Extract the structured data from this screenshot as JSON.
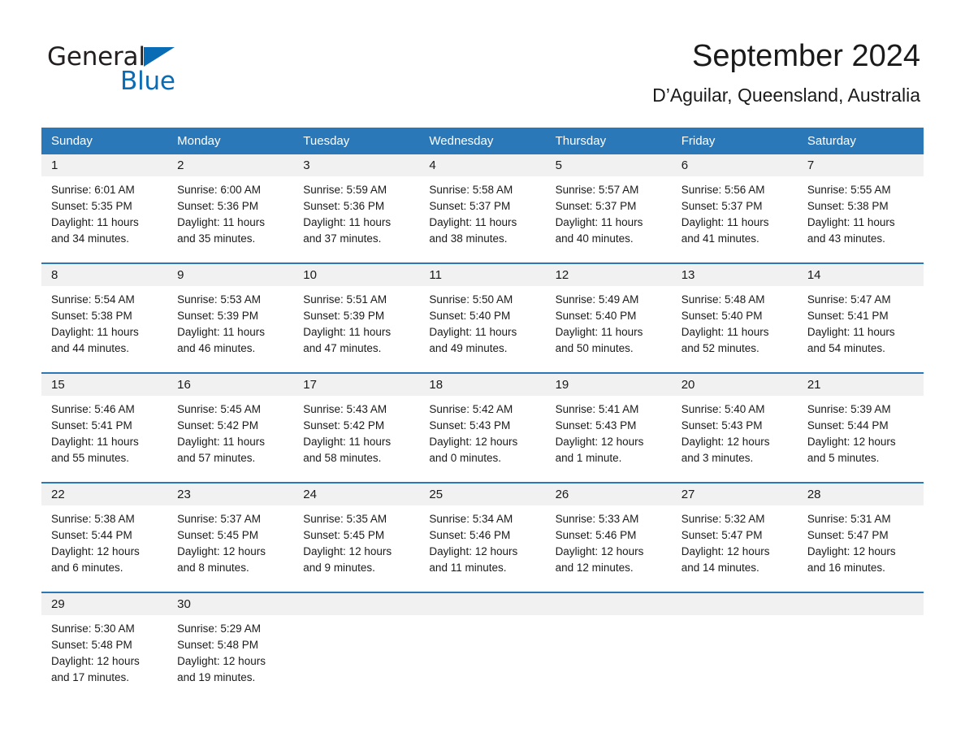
{
  "brand": {
    "word1": "General",
    "word2": "Blue",
    "triangle_color": "#0a6cb4"
  },
  "header": {
    "title": "September 2024",
    "location": "D’Aguilar, Queensland, Australia"
  },
  "theme": {
    "header_blue": "#2b78b9",
    "daynum_band": "#f1f1f1",
    "text": "#1a1a1a"
  },
  "weekdays": [
    "Sunday",
    "Monday",
    "Tuesday",
    "Wednesday",
    "Thursday",
    "Friday",
    "Saturday"
  ],
  "weeks": [
    [
      {
        "day": "1",
        "sunrise": "Sunrise: 6:01 AM",
        "sunset": "Sunset: 5:35 PM",
        "daylight": "Daylight: 11 hours and 34 minutes."
      },
      {
        "day": "2",
        "sunrise": "Sunrise: 6:00 AM",
        "sunset": "Sunset: 5:36 PM",
        "daylight": "Daylight: 11 hours and 35 minutes."
      },
      {
        "day": "3",
        "sunrise": "Sunrise: 5:59 AM",
        "sunset": "Sunset: 5:36 PM",
        "daylight": "Daylight: 11 hours and 37 minutes."
      },
      {
        "day": "4",
        "sunrise": "Sunrise: 5:58 AM",
        "sunset": "Sunset: 5:37 PM",
        "daylight": "Daylight: 11 hours and 38 minutes."
      },
      {
        "day": "5",
        "sunrise": "Sunrise: 5:57 AM",
        "sunset": "Sunset: 5:37 PM",
        "daylight": "Daylight: 11 hours and 40 minutes."
      },
      {
        "day": "6",
        "sunrise": "Sunrise: 5:56 AM",
        "sunset": "Sunset: 5:37 PM",
        "daylight": "Daylight: 11 hours and 41 minutes."
      },
      {
        "day": "7",
        "sunrise": "Sunrise: 5:55 AM",
        "sunset": "Sunset: 5:38 PM",
        "daylight": "Daylight: 11 hours and 43 minutes."
      }
    ],
    [
      {
        "day": "8",
        "sunrise": "Sunrise: 5:54 AM",
        "sunset": "Sunset: 5:38 PM",
        "daylight": "Daylight: 11 hours and 44 minutes."
      },
      {
        "day": "9",
        "sunrise": "Sunrise: 5:53 AM",
        "sunset": "Sunset: 5:39 PM",
        "daylight": "Daylight: 11 hours and 46 minutes."
      },
      {
        "day": "10",
        "sunrise": "Sunrise: 5:51 AM",
        "sunset": "Sunset: 5:39 PM",
        "daylight": "Daylight: 11 hours and 47 minutes."
      },
      {
        "day": "11",
        "sunrise": "Sunrise: 5:50 AM",
        "sunset": "Sunset: 5:40 PM",
        "daylight": "Daylight: 11 hours and 49 minutes."
      },
      {
        "day": "12",
        "sunrise": "Sunrise: 5:49 AM",
        "sunset": "Sunset: 5:40 PM",
        "daylight": "Daylight: 11 hours and 50 minutes."
      },
      {
        "day": "13",
        "sunrise": "Sunrise: 5:48 AM",
        "sunset": "Sunset: 5:40 PM",
        "daylight": "Daylight: 11 hours and 52 minutes."
      },
      {
        "day": "14",
        "sunrise": "Sunrise: 5:47 AM",
        "sunset": "Sunset: 5:41 PM",
        "daylight": "Daylight: 11 hours and 54 minutes."
      }
    ],
    [
      {
        "day": "15",
        "sunrise": "Sunrise: 5:46 AM",
        "sunset": "Sunset: 5:41 PM",
        "daylight": "Daylight: 11 hours and 55 minutes."
      },
      {
        "day": "16",
        "sunrise": "Sunrise: 5:45 AM",
        "sunset": "Sunset: 5:42 PM",
        "daylight": "Daylight: 11 hours and 57 minutes."
      },
      {
        "day": "17",
        "sunrise": "Sunrise: 5:43 AM",
        "sunset": "Sunset: 5:42 PM",
        "daylight": "Daylight: 11 hours and 58 minutes."
      },
      {
        "day": "18",
        "sunrise": "Sunrise: 5:42 AM",
        "sunset": "Sunset: 5:43 PM",
        "daylight": "Daylight: 12 hours and 0 minutes."
      },
      {
        "day": "19",
        "sunrise": "Sunrise: 5:41 AM",
        "sunset": "Sunset: 5:43 PM",
        "daylight": "Daylight: 12 hours and 1 minute."
      },
      {
        "day": "20",
        "sunrise": "Sunrise: 5:40 AM",
        "sunset": "Sunset: 5:43 PM",
        "daylight": "Daylight: 12 hours and 3 minutes."
      },
      {
        "day": "21",
        "sunrise": "Sunrise: 5:39 AM",
        "sunset": "Sunset: 5:44 PM",
        "daylight": "Daylight: 12 hours and 5 minutes."
      }
    ],
    [
      {
        "day": "22",
        "sunrise": "Sunrise: 5:38 AM",
        "sunset": "Sunset: 5:44 PM",
        "daylight": "Daylight: 12 hours and 6 minutes."
      },
      {
        "day": "23",
        "sunrise": "Sunrise: 5:37 AM",
        "sunset": "Sunset: 5:45 PM",
        "daylight": "Daylight: 12 hours and 8 minutes."
      },
      {
        "day": "24",
        "sunrise": "Sunrise: 5:35 AM",
        "sunset": "Sunset: 5:45 PM",
        "daylight": "Daylight: 12 hours and 9 minutes."
      },
      {
        "day": "25",
        "sunrise": "Sunrise: 5:34 AM",
        "sunset": "Sunset: 5:46 PM",
        "daylight": "Daylight: 12 hours and 11 minutes."
      },
      {
        "day": "26",
        "sunrise": "Sunrise: 5:33 AM",
        "sunset": "Sunset: 5:46 PM",
        "daylight": "Daylight: 12 hours and 12 minutes."
      },
      {
        "day": "27",
        "sunrise": "Sunrise: 5:32 AM",
        "sunset": "Sunset: 5:47 PM",
        "daylight": "Daylight: 12 hours and 14 minutes."
      },
      {
        "day": "28",
        "sunrise": "Sunrise: 5:31 AM",
        "sunset": "Sunset: 5:47 PM",
        "daylight": "Daylight: 12 hours and 16 minutes."
      }
    ],
    [
      {
        "day": "29",
        "sunrise": "Sunrise: 5:30 AM",
        "sunset": "Sunset: 5:48 PM",
        "daylight": "Daylight: 12 hours and 17 minutes."
      },
      {
        "day": "30",
        "sunrise": "Sunrise: 5:29 AM",
        "sunset": "Sunset: 5:48 PM",
        "daylight": "Daylight: 12 hours and 19 minutes."
      },
      {
        "day": "",
        "sunrise": "",
        "sunset": "",
        "daylight": ""
      },
      {
        "day": "",
        "sunrise": "",
        "sunset": "",
        "daylight": ""
      },
      {
        "day": "",
        "sunrise": "",
        "sunset": "",
        "daylight": ""
      },
      {
        "day": "",
        "sunrise": "",
        "sunset": "",
        "daylight": ""
      },
      {
        "day": "",
        "sunrise": "",
        "sunset": "",
        "daylight": ""
      }
    ]
  ]
}
